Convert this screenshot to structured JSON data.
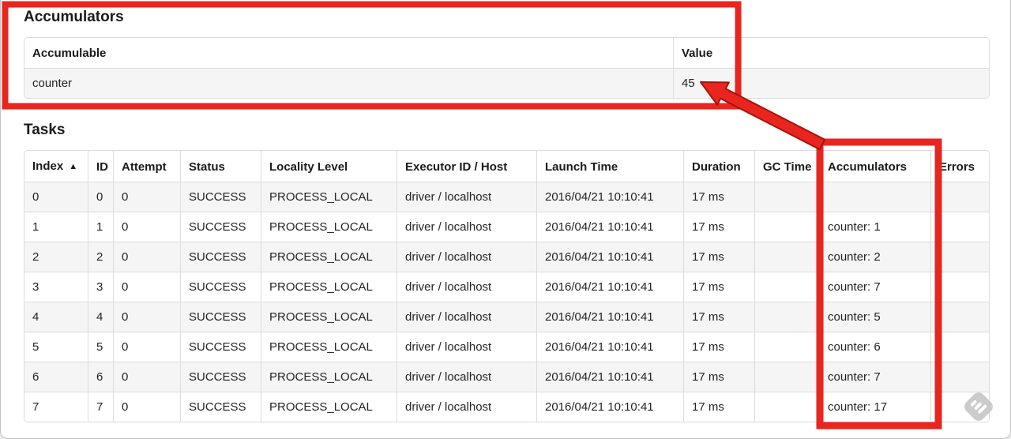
{
  "accumulators": {
    "title": "Accumulators",
    "headers": [
      "Accumulable",
      "Value"
    ],
    "rows": [
      [
        "counter",
        "45"
      ]
    ]
  },
  "tasks": {
    "title": "Tasks",
    "headers": [
      "Index",
      "ID",
      "Attempt",
      "Status",
      "Locality Level",
      "Executor ID / Host",
      "Launch Time",
      "Duration",
      "GC Time",
      "Accumulators",
      "Errors"
    ],
    "sort_indicator": "▲",
    "rows": [
      [
        "0",
        "0",
        "0",
        "SUCCESS",
        "PROCESS_LOCAL",
        "driver / localhost",
        "2016/04/21 10:10:41",
        "17 ms",
        "",
        "",
        ""
      ],
      [
        "1",
        "1",
        "0",
        "SUCCESS",
        "PROCESS_LOCAL",
        "driver / localhost",
        "2016/04/21 10:10:41",
        "17 ms",
        "",
        "counter: 1",
        ""
      ],
      [
        "2",
        "2",
        "0",
        "SUCCESS",
        "PROCESS_LOCAL",
        "driver / localhost",
        "2016/04/21 10:10:41",
        "17 ms",
        "",
        "counter: 2",
        ""
      ],
      [
        "3",
        "3",
        "0",
        "SUCCESS",
        "PROCESS_LOCAL",
        "driver / localhost",
        "2016/04/21 10:10:41",
        "17 ms",
        "",
        "counter: 7",
        ""
      ],
      [
        "4",
        "4",
        "0",
        "SUCCESS",
        "PROCESS_LOCAL",
        "driver / localhost",
        "2016/04/21 10:10:41",
        "17 ms",
        "",
        "counter: 5",
        ""
      ],
      [
        "5",
        "5",
        "0",
        "SUCCESS",
        "PROCESS_LOCAL",
        "driver / localhost",
        "2016/04/21 10:10:41",
        "17 ms",
        "",
        "counter: 6",
        ""
      ],
      [
        "6",
        "6",
        "0",
        "SUCCESS",
        "PROCESS_LOCAL",
        "driver / localhost",
        "2016/04/21 10:10:41",
        "17 ms",
        "",
        "counter: 7",
        ""
      ],
      [
        "7",
        "7",
        "0",
        "SUCCESS",
        "PROCESS_LOCAL",
        "driver / localhost",
        "2016/04/21 10:10:41",
        "17 ms",
        "",
        "counter: 17",
        ""
      ]
    ]
  },
  "annotations": {
    "highlight_color": "#e8261f",
    "arrow_outline_color": "#a8120b",
    "shapes": [
      "box-around-accumulators-section",
      "box-around-accumulators-column",
      "arrow-pointing-at-value-45"
    ]
  },
  "watermark": {
    "icon": "skitch-logo",
    "color": "#c7c7c7"
  }
}
